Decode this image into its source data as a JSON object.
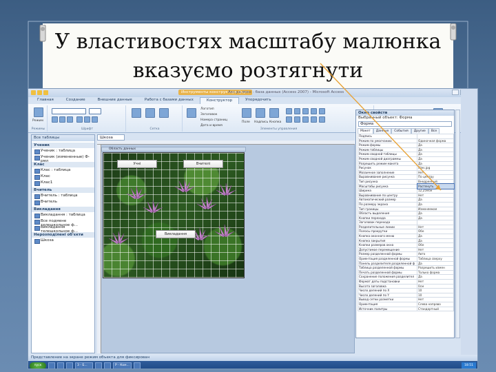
{
  "slide": {
    "title_line1": "У властивостях масштабу малюнка",
    "title_line2": "вказуємо розтягнути"
  },
  "window": {
    "context_tab": "Инструменты конструктора форм",
    "title": "Акс.ра.мокс : база данных (Access 2007) - Microsoft Access",
    "tabs": [
      "Главная",
      "Создание",
      "Внешние данные",
      "Работа с базами данных",
      "Конструктор",
      "Упорядочить"
    ],
    "active_tab_index": 4,
    "ribbon": {
      "groups": [
        "Режимы",
        "Шрифт",
        "Сетка",
        "Элементы управления",
        "Сервис"
      ],
      "view_label": "Режим",
      "controls": [
        "Логотип",
        "Заголовок",
        "Номера страниц",
        "Дата и время"
      ],
      "tools": [
        "Поле",
        "Надпись",
        "Кнопка"
      ]
    },
    "nav": {
      "header": "Все таблицы",
      "groups": [
        {
          "name": "Ученик",
          "items": [
            "Ученик : таблица",
            "Ученик (измененные) Ф-рмл"
          ]
        },
        {
          "name": "Клас",
          "items": [
            "Клас : таблица",
            "Клас",
            "Клас1"
          ]
        },
        {
          "name": "Вчитель",
          "items": [
            "Вчитель : таблица",
            "Вчитель"
          ]
        },
        {
          "name": "Викладання",
          "items": [
            "Викладання : таблица",
            "Все подмене телешкольное ф...",
            "Викладання телешкольное ф..."
          ]
        },
        {
          "name": "Нерозподілені об'єкти",
          "items": [
            "Шкоза"
          ]
        }
      ]
    },
    "form": {
      "tab_label": "Шкоза",
      "section_label": "Область данных",
      "buttons": [
        "Учні",
        "Вчителі",
        "Викладання"
      ]
    },
    "props": {
      "title": "Окно свойств",
      "selection_type": "Выбранный объект: Форма",
      "combo": "Форма",
      "tabs": [
        "Макет",
        "Данные",
        "События",
        "Другие",
        "Все"
      ],
      "rows": [
        [
          "Подпись",
          ""
        ],
        [
          "Режим по умолчанию",
          "Одиночная форма"
        ],
        [
          "Режим формы",
          "Да"
        ],
        [
          "Режим таблицы",
          "Да"
        ],
        [
          "Режим сводной таблицы",
          "Да"
        ],
        [
          "Режим сводной диаграммы",
          "Да"
        ],
        [
          "Разрешить режим макета",
          "Да"
        ],
        [
          "Рисунок",
          "lilies.jpg"
        ],
        [
          "Мозаичное заполнение",
          "Нет"
        ],
        [
          "Выравнивание рисунка",
          "По центру"
        ],
        [
          "Тип рисунка",
          "Внедренный"
        ],
        [
          "Масштабы рисунка",
          "Растянуть"
        ],
        [
          "Ширина",
          "12,259см"
        ],
        [
          "Выравнивание по центру",
          "Нет"
        ],
        [
          "Автоматический размер",
          "Да"
        ],
        [
          "По размеру экрана",
          "Да"
        ],
        [
          "Тип границы",
          "Изменяемая"
        ],
        [
          "Область выделения",
          "Да"
        ],
        [
          "Кнопки перехода",
          "Да"
        ],
        [
          "Заголовок перехода",
          ""
        ],
        [
          "Разделительные линии",
          "Нет"
        ],
        [
          "Полосы прокрутки",
          "Обе"
        ],
        [
          "Кнопка оконного меню",
          "Да"
        ],
        [
          "Кнопка закрытия",
          "Да"
        ],
        [
          "Кнопки размеров окна",
          "Обе"
        ],
        [
          "Допустимое перемещение",
          "Нет"
        ],
        [
          "Размер разделенной формы",
          "Авто"
        ],
        [
          "Ориентация разделенной формы",
          "Таблица сверху"
        ],
        [
          "Панель разделителя разделенной ф",
          "Да"
        ],
        [
          "Таблица разделенной формы",
          "Разрешить измен"
        ],
        [
          "Печать разделенной формы",
          "Только форма"
        ],
        [
          "Сохранение положения разделител",
          "Да"
        ],
        [
          "Формат даты подстановки",
          "Нет"
        ],
        [
          "Высота заголовка",
          "0см"
        ],
        [
          "Число делений по X",
          "10"
        ],
        [
          "Число делений по Y",
          "10"
        ],
        [
          "Вывод сетки разметки",
          "Нет"
        ],
        [
          "Ориентация",
          "Слева направо"
        ],
        [
          "Источник палитры",
          "Стандартный"
        ]
      ],
      "highlight_row": 11
    },
    "status": "Представление на экране режим объекта для фиксирован",
    "taskbar": {
      "start": "пуск",
      "buttons": [
        "",
        "",
        "",
        "3 - Б...",
        "",
        "",
        "Р - Ком...",
        ""
      ],
      "tray": "18:51"
    }
  }
}
